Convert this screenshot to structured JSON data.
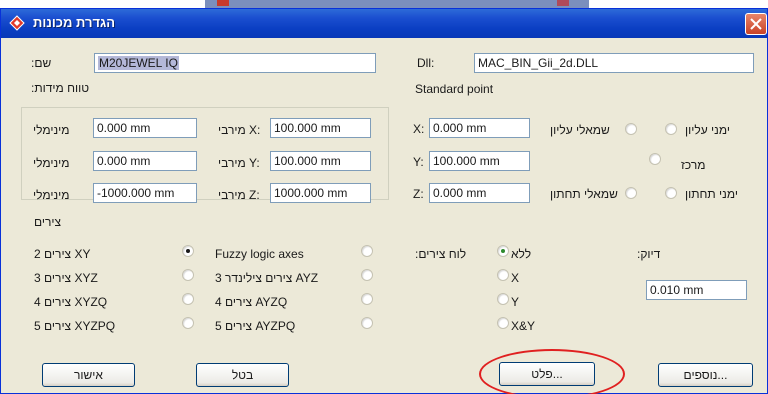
{
  "window": {
    "title": "הגדרת מכונות"
  },
  "name_field": {
    "label": "שם:",
    "value": "M20JEWEL IQ"
  },
  "dll_field": {
    "label": "Dll:",
    "value": "MAC_BIN_Gii_2d.DLL"
  },
  "measure_section": {
    "title": "טווח מידות:"
  },
  "standard_point": {
    "title": "Standard point"
  },
  "ranges": [
    {
      "min_label": "מינימלי",
      "min_value": "0.000 mm",
      "max_label": "מירבי X:",
      "max_value": "100.000 mm"
    },
    {
      "min_label": "מינימלי",
      "min_value": "0.000 mm",
      "max_label": "מירבי Y:",
      "max_value": "100.000 mm"
    },
    {
      "min_label": "מינימלי",
      "min_value": "-1000.000 mm",
      "max_label": "מירבי Z:",
      "max_value": "1000.000 mm"
    }
  ],
  "std_points": [
    {
      "label": "X:",
      "value": "0.000 mm"
    },
    {
      "label": "Y:",
      "value": "100.000 mm"
    },
    {
      "label": "Z:",
      "value": "0.000 mm"
    }
  ],
  "corners": {
    "top_left": "שמאלי עליון",
    "top_right": "ימני עליון",
    "center": "מרכז",
    "bottom_left": "שמאלי תחתון",
    "bottom_right": "ימני תחתון"
  },
  "axes_section": {
    "title": "צירים"
  },
  "axes_left": [
    "2 צירים XY",
    "3 צירים XYZ",
    "4 צירים XYZQ",
    "5 צירים XYZPQ"
  ],
  "axes_right": [
    "Fuzzy logic axes",
    "3 צירים צילינדר AYZ",
    "4 צירים AYZQ",
    "5 צירים AYZPQ"
  ],
  "board_section": {
    "title": "לוח צירים:"
  },
  "board_options": [
    "ללא",
    "X",
    "Y",
    "X&Y"
  ],
  "precision": {
    "label": "דיוק:",
    "value": "0.010 mm"
  },
  "buttons": {
    "ok": "אישור",
    "cancel": "בטל",
    "plot": "פלט...",
    "more": "נוספים..."
  }
}
